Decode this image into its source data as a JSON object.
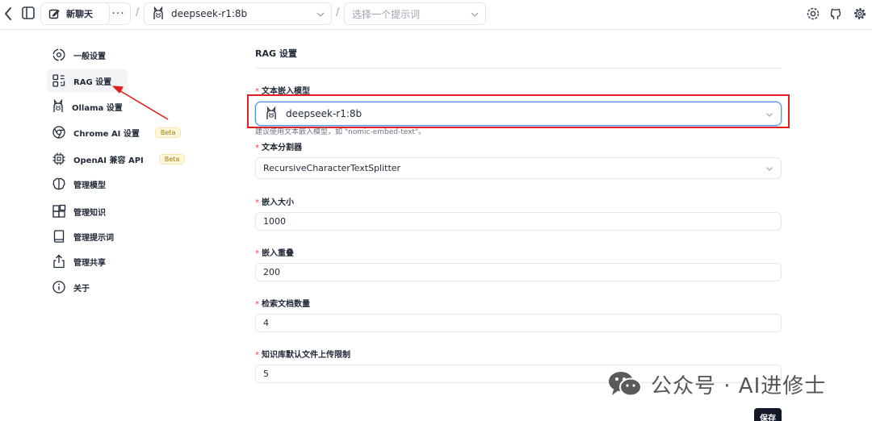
{
  "topbar": {
    "new_chat_label": "新聊天",
    "more_label": "···",
    "separator": "/",
    "selected_model": "deepseek-r1:8b",
    "prompt_placeholder": "选择一个提示词"
  },
  "sidebar": {
    "items": [
      {
        "label": "一般设置",
        "icon": "gear-icon"
      },
      {
        "label": "RAG 设置",
        "icon": "rag-icon",
        "active": true
      },
      {
        "label": "Ollama 设置",
        "icon": "ollama-icon"
      },
      {
        "label": "Chrome AI 设置",
        "icon": "chrome-icon",
        "badge": "Beta"
      },
      {
        "label": "OpenAI 兼容 API",
        "icon": "chip-icon",
        "badge": "Beta"
      },
      {
        "label": "管理模型",
        "icon": "brain-icon"
      },
      {
        "label": "管理知识",
        "icon": "blocks-icon"
      },
      {
        "label": "管理提示词",
        "icon": "book-icon"
      },
      {
        "label": "管理共享",
        "icon": "share-icon"
      },
      {
        "label": "关于",
        "icon": "info-icon"
      }
    ]
  },
  "main": {
    "title": "RAG 设置",
    "embedding_model": {
      "label": "文本嵌入模型",
      "value": "deepseek-r1:8b",
      "hint": "建议使用文本嵌入模型，如 \"nomic-embed-text\"。"
    },
    "splitter": {
      "label": "文本分割器",
      "value": "RecursiveCharacterTextSplitter"
    },
    "chunk_size": {
      "label": "嵌入大小",
      "value": "1000"
    },
    "chunk_overlap": {
      "label": "嵌入重叠",
      "value": "200"
    },
    "retrieval_count": {
      "label": "检索文档数量",
      "value": "4"
    },
    "upload_limit": {
      "label": "知识库默认文件上传限制",
      "value": "5"
    },
    "required_mark": "*",
    "save_label": "保存"
  },
  "watermark": {
    "text": "公众号 · AI进修士"
  },
  "colors": {
    "accent_border": "#4f8ff0",
    "annotation_red": "#e02020",
    "beta_bg": "#fdf6d9"
  }
}
